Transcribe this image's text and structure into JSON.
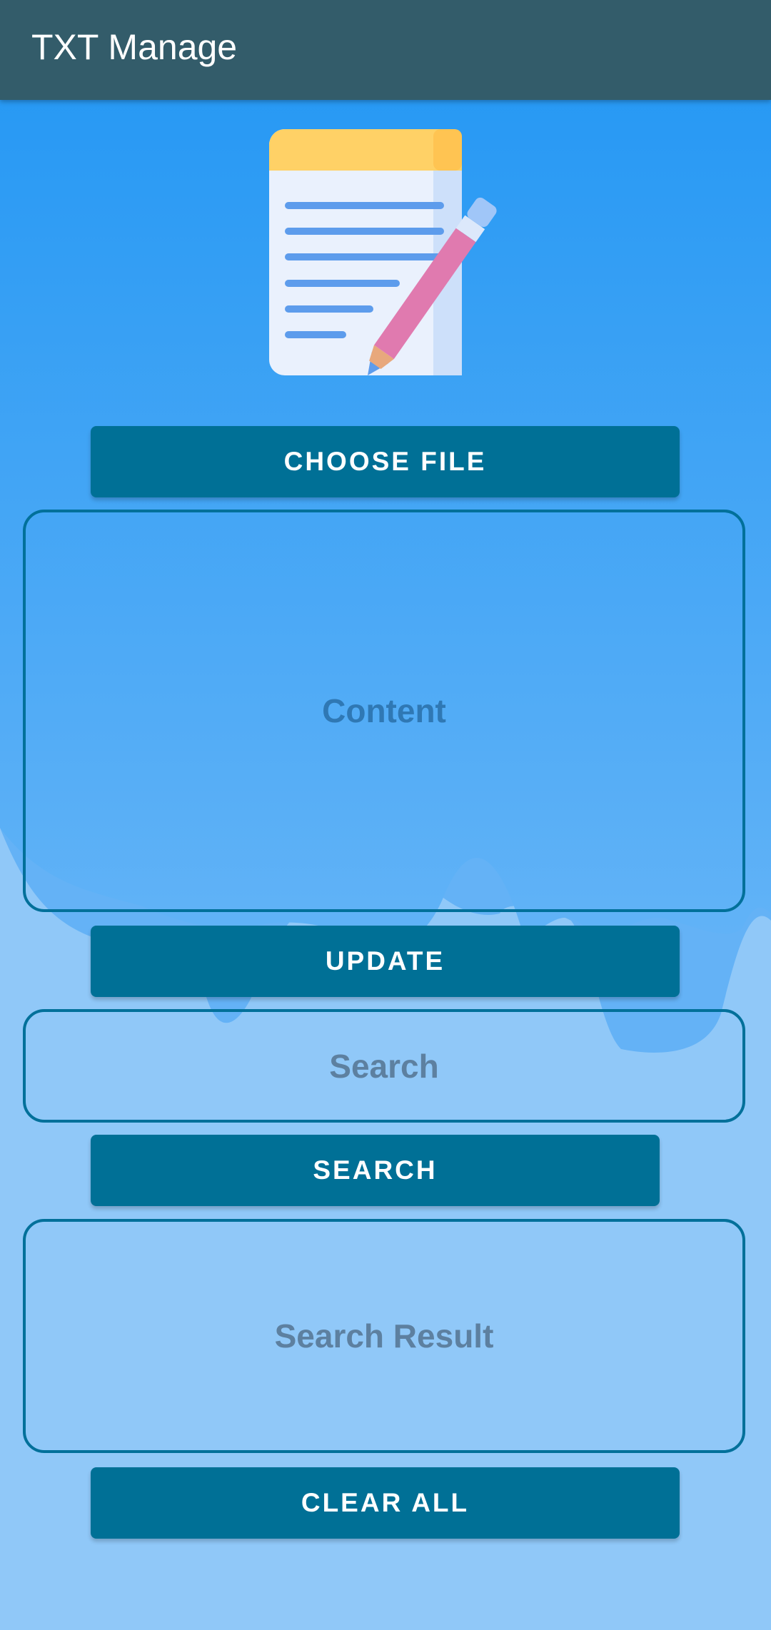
{
  "app_bar": {
    "title": "TXT Manage"
  },
  "logo": {
    "icon": "notepad-with-pencil-icon"
  },
  "buttons": {
    "choose_file": "CHOOSE FILE",
    "update": "UPDATE",
    "search": "SEARCH",
    "clear_all": "CLEAR ALL"
  },
  "fields": {
    "content_placeholder": "Content",
    "search_placeholder": "Search",
    "search_result_placeholder": "Search Result"
  },
  "colors": {
    "app_bar": "#335c6a",
    "button": "#007096",
    "background_top": "#2196f3",
    "background_bottom": "#90c8f8"
  }
}
